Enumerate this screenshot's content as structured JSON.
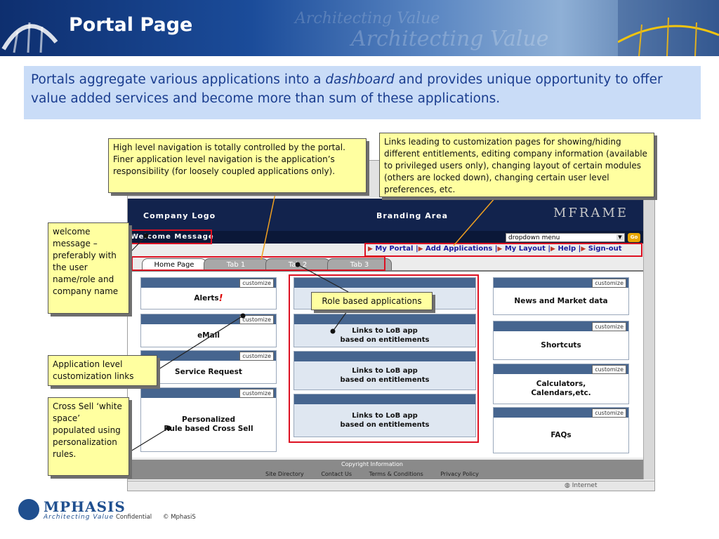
{
  "slide": {
    "title": "Portal Page",
    "watermark_small": "Architecting Value",
    "watermark_large": "Architecting Value",
    "intro_pre": "Portals aggregate various applications into a ",
    "intro_emph": "dashboard",
    "intro_post": " and provides unique opportunity to offer value added services and become more than sum of these applications."
  },
  "portal": {
    "company_logo": "Company Logo",
    "branding": "Branding Area",
    "mframe": "MFRAME",
    "welcome": "Welcome Message",
    "dropdown": "dropdown menu",
    "go": "Go",
    "top_links": [
      "My Portal",
      "Add Applications",
      "My Layout",
      "Help",
      "Sign-out"
    ],
    "tabs": [
      "Home Page",
      "Tab 1",
      "Tab 2",
      "Tab 3"
    ],
    "customize_label": "customize",
    "left_portlets": [
      "Alerts",
      "eMail",
      "Service Request",
      "Personalized\nRule based Cross Sell"
    ],
    "alert_mark": "!",
    "mid_portlets": [
      "",
      "Links to LoB app\nbased on entitlements",
      "Links to LoB app\nbased on entitlements",
      "Links to LoB app\nbased on entitlements"
    ],
    "right_portlets": [
      "News and Market data",
      "Shortcuts",
      "Calculators,\nCalendars,etc.",
      "FAQs"
    ],
    "footer_copyright": "Copyright Information",
    "footer_links": [
      "Site Directory",
      "Contact Us",
      "Terms & Conditions",
      "Privacy Policy"
    ],
    "status_internet": "Internet"
  },
  "callouts": {
    "high_level": "High level navigation is totally controlled by the portal. Finer application level navigation is the application’s responsibility (for loosely coupled applications only).",
    "links_leading": "Links leading to customization pages for showing/hiding different entitlements, editing company information (available to privileged users only), changing layout of certain modules (others are locked down), changing certain user level preferences, etc.",
    "welcome": "welcome message – preferably with the user name/role and company name",
    "role_based": "Role based applications",
    "app_level": "Application level customization links",
    "cross_sell": "Cross Sell ‘white space’ populated using personalization rules."
  },
  "footer": {
    "company": "MPHASIS",
    "tagline": "Architecting Value",
    "confidential": "Confidential",
    "copyright": "© MphasiS"
  },
  "colors": {
    "title_band": "#1b4c9a",
    "intro_bg": "#c9dcf7",
    "intro_text": "#1a3d8f",
    "callout_bg": "#ffffa0",
    "highlight": "#dd1122",
    "portlet_bar": "#46658f"
  }
}
